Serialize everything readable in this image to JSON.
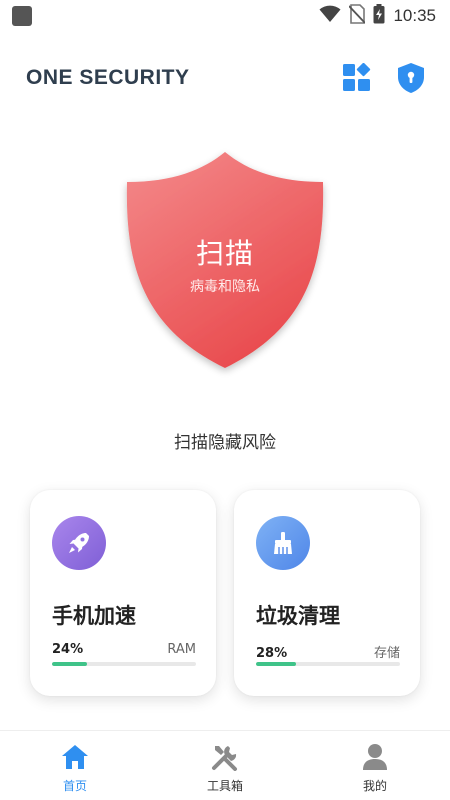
{
  "status_bar": {
    "time": "10:35",
    "icons": [
      "app-notification-icon",
      "wifi-icon",
      "no-sim-icon",
      "battery-charging-icon"
    ]
  },
  "header": {
    "title": "ONE SECURITY",
    "actions": [
      "grid-apps-icon",
      "shield-lock-icon"
    ]
  },
  "shield": {
    "title": "扫描",
    "subtitle": "病毒和隐私"
  },
  "scan_hint": "扫描隐藏风险",
  "cards": [
    {
      "title": "手机加速",
      "percent": "24%",
      "unit": "RAM",
      "progress": 0.24,
      "icon": "rocket-icon"
    },
    {
      "title": "垃圾清理",
      "percent": "28%",
      "unit": "存储",
      "progress": 0.28,
      "icon": "broom-icon"
    }
  ],
  "bottom_nav": {
    "items": [
      {
        "label": "首页",
        "icon": "home-icon",
        "active": true
      },
      {
        "label": "工具箱",
        "icon": "tools-icon",
        "active": false
      },
      {
        "label": "我的",
        "icon": "profile-icon",
        "active": false
      }
    ]
  },
  "colors": {
    "accent": "#2f8ff0",
    "shield": "#ee5a5c",
    "progress": "#3fc389",
    "title": "#2f3e4e"
  }
}
